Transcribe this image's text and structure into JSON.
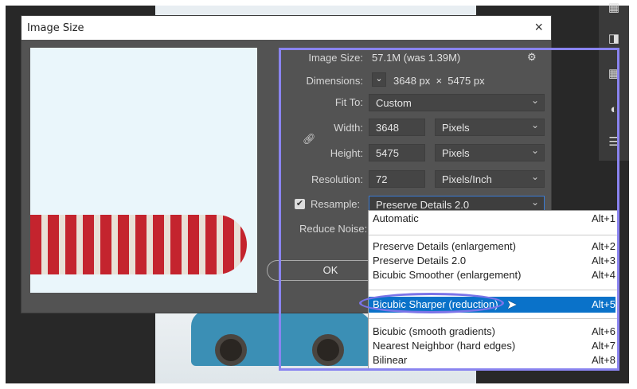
{
  "dialog": {
    "title": "Image Size",
    "close": "×"
  },
  "image_size": {
    "label": "Image Size:",
    "value": "57.1M (was 1.39M)"
  },
  "dimensions": {
    "label": "Dimensions:",
    "value": "3648 px  ×  5475 px"
  },
  "fit_to": {
    "label": "Fit To:",
    "value": "Custom"
  },
  "width": {
    "label": "Width:",
    "value": "3648",
    "unit": "Pixels"
  },
  "height": {
    "label": "Height:",
    "value": "5475",
    "unit": "Pixels"
  },
  "resolution": {
    "label": "Resolution:",
    "value": "72",
    "unit": "Pixels/Inch"
  },
  "resample": {
    "label": "Resample:",
    "value": "Preserve Details 2.0",
    "checked": true
  },
  "reduce_noise": {
    "label": "Reduce Noise:"
  },
  "ok_label": "OK",
  "menu": [
    {
      "label": "Automatic",
      "key": "Alt+1"
    },
    {
      "label": "Preserve Details (enlargement)",
      "key": "Alt+2"
    },
    {
      "label": "Preserve Details 2.0",
      "key": "Alt+3"
    },
    {
      "label": "Bicubic Smoother (enlargement)",
      "key": "Alt+4"
    },
    {
      "label": "Bicubic Sharper (reduction)",
      "key": "Alt+5"
    },
    {
      "label": "Bicubic (smooth gradients)",
      "key": "Alt+6"
    },
    {
      "label": "Nearest Neighbor (hard edges)",
      "key": "Alt+7"
    },
    {
      "label": "Bilinear",
      "key": "Alt+8"
    }
  ],
  "colors": {
    "highlight": "#0a72c9",
    "annotation": "#8a84f0"
  }
}
